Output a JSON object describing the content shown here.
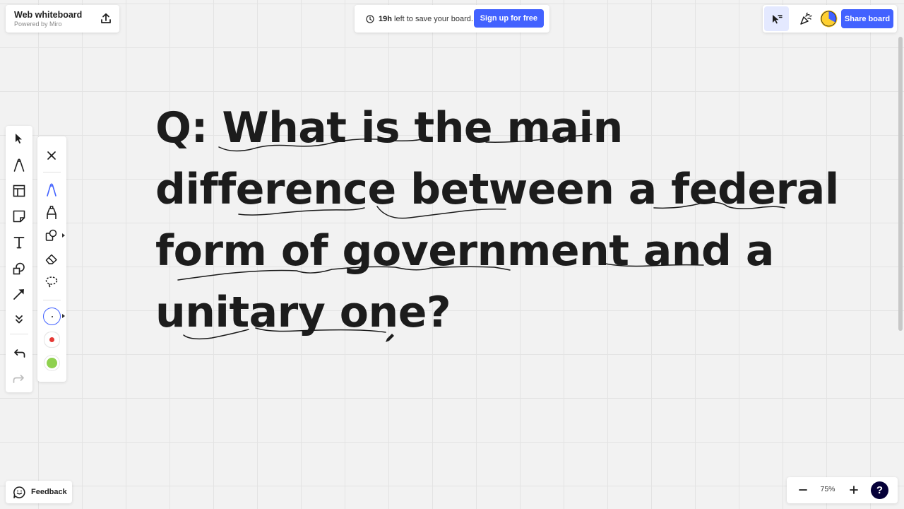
{
  "header": {
    "board_title": "Web whiteboard",
    "board_subtitle": "Powered by Miro",
    "export_icon": "upload-icon"
  },
  "banner": {
    "time_bold": "19h",
    "time_text": " left to save your board.",
    "signup_label": "Sign up for free",
    "clock_icon": "clock-icon"
  },
  "top_right": {
    "collab_icon": "cursor-filter-icon",
    "reactions_icon": "party-popper-icon",
    "share_label": "Share board",
    "avatar_colors": [
      "#ffd02f",
      "#4262ff"
    ]
  },
  "toolbar": {
    "tools": [
      "select",
      "pen",
      "templates",
      "sticky-note",
      "text",
      "shapes",
      "arrow",
      "more"
    ],
    "undo_icon": "undo-icon",
    "redo_icon": "redo-icon"
  },
  "pen_panel": {
    "tools": [
      "close",
      "pen",
      "marker",
      "shape-recognizer",
      "eraser",
      "lasso"
    ],
    "colors": [
      "#ffffff",
      "#e53935",
      "#8fd14f"
    ],
    "selected_color_index": 0
  },
  "canvas": {
    "lines": [
      "Q: What is the main",
      "difference between a federal",
      "form of government and a",
      "unitary one?"
    ]
  },
  "footer": {
    "feedback_label": "Feedback",
    "zoom_level": "75%",
    "help_label": "?"
  },
  "colors": {
    "accent": "#4262ff",
    "help_bg": "#050038",
    "canvas_bg": "#f2f2f2",
    "ink": "#1a1a1a"
  }
}
